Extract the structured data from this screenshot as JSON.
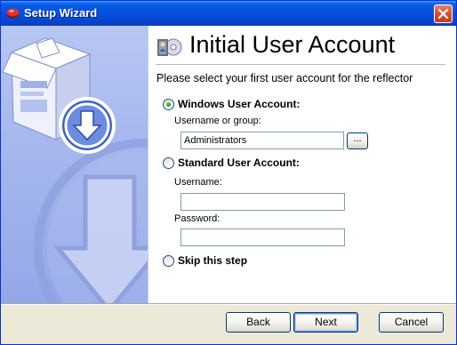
{
  "window": {
    "title": "Setup Wizard",
    "titlebar_color": "#0551e0"
  },
  "header": {
    "title": "Initial User Account",
    "subtitle": "Please select your first user account for the reflector"
  },
  "options": {
    "windows": {
      "label": "Windows User Account:",
      "selected": true,
      "username_label": "Username or group:",
      "username_value": "Administrators",
      "browse_label": "..."
    },
    "standard": {
      "label": "Standard User Account:",
      "selected": false,
      "username_label": "Username:",
      "username_value": "",
      "password_label": "Password:",
      "password_value": ""
    },
    "skip": {
      "label": "Skip this step",
      "selected": false
    }
  },
  "buttons": {
    "back": "Back",
    "next": "Next",
    "cancel": "Cancel"
  },
  "icons": {
    "title": "setup-icon",
    "close": "close-icon",
    "header": "user-disc-icon",
    "side": "install-box-icon"
  }
}
